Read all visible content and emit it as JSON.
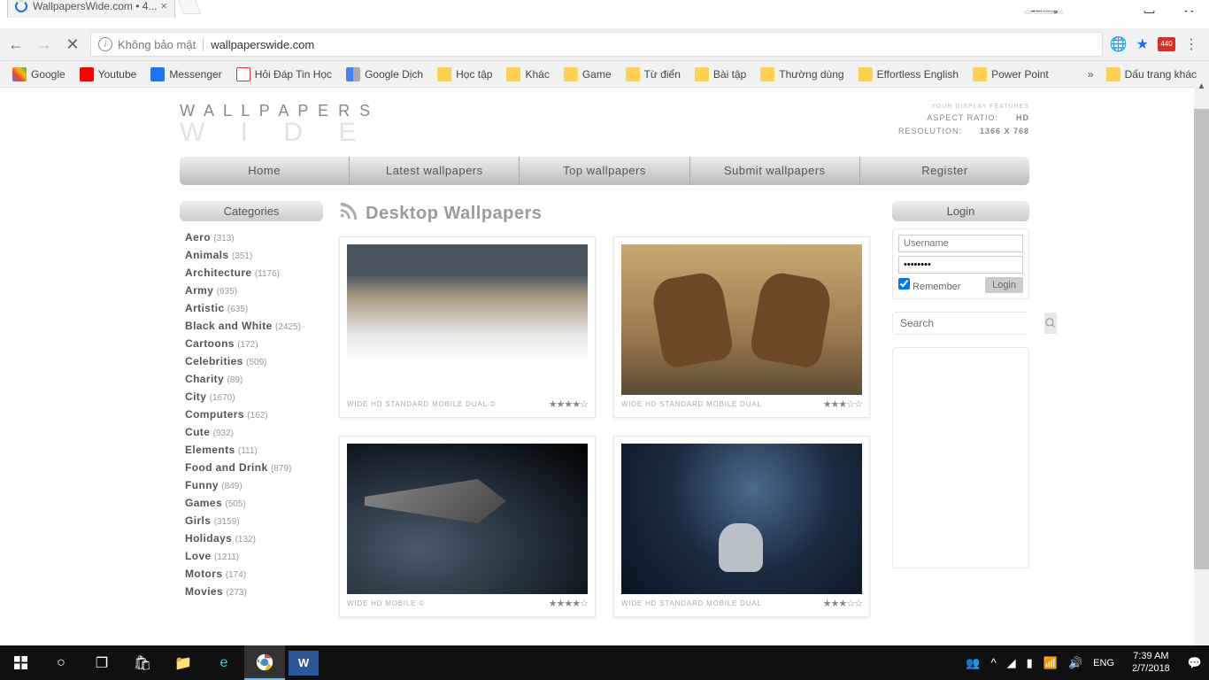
{
  "browser": {
    "tab_title": "WallpapersWide.com • 4...",
    "gaming_badge": "Gaming",
    "url_security": "Không bảo mật",
    "url_domain": "wallpaperswide.com",
    "ext_badge": "440",
    "more_bookmarks": "Dấu trang khác",
    "bookmarks": [
      {
        "label": "Google",
        "ico": "g"
      },
      {
        "label": "Youtube",
        "ico": "yt"
      },
      {
        "label": "Messenger",
        "ico": "fb"
      },
      {
        "label": "Hỏi Đáp Tin Học",
        "ico": "v"
      },
      {
        "label": "Google Dịch",
        "ico": "gt"
      },
      {
        "label": "Học tập",
        "ico": "f"
      },
      {
        "label": "Khác",
        "ico": "f"
      },
      {
        "label": "Game",
        "ico": "f"
      },
      {
        "label": "Từ điển",
        "ico": "f"
      },
      {
        "label": "Bài tập",
        "ico": "f"
      },
      {
        "label": "Thường dùng",
        "ico": "f"
      },
      {
        "label": "Effortless English",
        "ico": "f"
      },
      {
        "label": "Power Point",
        "ico": "f"
      }
    ]
  },
  "site": {
    "logo1": "W A L L P A P E R S",
    "logo2": "W I D E",
    "display_label": "YOUR DISPLAY FEATURES",
    "aspect_label": "ASPECT RATIO:",
    "aspect_val": "HD",
    "res_label": "RESOLUTION:",
    "res_val": "1366 X 768",
    "nav": [
      "Home",
      "Latest wallpapers",
      "Top wallpapers",
      "Submit wallpapers",
      "Register"
    ],
    "categories_title": "Categories",
    "categories": [
      {
        "name": "Aero",
        "count": "(313)"
      },
      {
        "name": "Animals",
        "count": "(351)"
      },
      {
        "name": "Architecture",
        "count": "(1176)"
      },
      {
        "name": "Army",
        "count": "(935)"
      },
      {
        "name": "Artistic",
        "count": "(635)"
      },
      {
        "name": "Black and White",
        "count": "(2425)"
      },
      {
        "name": "Cartoons",
        "count": "(172)"
      },
      {
        "name": "Celebrities",
        "count": "(509)"
      },
      {
        "name": "Charity",
        "count": "(89)"
      },
      {
        "name": "City",
        "count": "(1670)"
      },
      {
        "name": "Computers",
        "count": "(162)"
      },
      {
        "name": "Cute",
        "count": "(932)"
      },
      {
        "name": "Elements",
        "count": "(111)"
      },
      {
        "name": "Food and Drink",
        "count": "(879)"
      },
      {
        "name": "Funny",
        "count": "(849)"
      },
      {
        "name": "Games",
        "count": "(505)"
      },
      {
        "name": "Girls",
        "count": "(3159)"
      },
      {
        "name": "Holidays",
        "count": "(132)"
      },
      {
        "name": "Love",
        "count": "(1211)"
      },
      {
        "name": "Motors",
        "count": "(174)"
      },
      {
        "name": "Movies",
        "count": "(273)"
      }
    ],
    "page_title": "Desktop Wallpapers",
    "cards": [
      {
        "meta": "WIDE  HD  STANDARD  MOBILE  DUAL  ©",
        "stars": "★★★★☆"
      },
      {
        "meta": "WIDE  HD  STANDARD  MOBILE  DUAL",
        "stars": "★★★☆☆"
      },
      {
        "meta": "WIDE  HD  MOBILE  ©",
        "stars": "★★★★☆"
      },
      {
        "meta": "WIDE  HD  STANDARD  MOBILE  DUAL",
        "stars": "★★★☆☆"
      }
    ],
    "login_title": "Login",
    "username_ph": "Username",
    "password_val": "••••••••",
    "remember": "Remember",
    "login_btn": "Login",
    "search_ph": "Search"
  },
  "taskbar": {
    "lang": "ENG",
    "time": "7:39 AM",
    "date": "2/7/2018"
  }
}
